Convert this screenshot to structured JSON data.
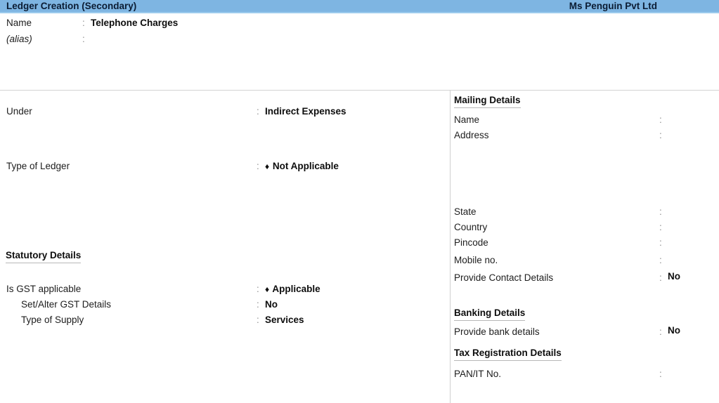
{
  "titlebar": {
    "screen_title": "Ledger Creation (Secondary)",
    "company_name": "Ms Penguin Pvt Ltd",
    "bar_color": "#7eb5e2",
    "text_color": "#0b1c33"
  },
  "identity": {
    "name_label": "Name",
    "name_value": "Telephone Charges",
    "alias_label": "(alias)",
    "alias_value": "",
    "colon": ":"
  },
  "left": {
    "under_label": "Under",
    "under_value": "Indirect Expenses",
    "type_of_ledger_label": "Type of Ledger",
    "type_of_ledger_value": "Not Applicable",
    "statutory_heading": "Statutory Details",
    "gst_applicable_label": "Is GST applicable",
    "gst_applicable_value": "Applicable",
    "set_alter_gst_label": "Set/Alter GST Details",
    "set_alter_gst_value": "No",
    "type_of_supply_label": "Type of Supply",
    "type_of_supply_value": "Services",
    "selector_marker": "♦"
  },
  "right": {
    "mailing_heading": "Mailing Details",
    "mailing_name_label": "Name",
    "mailing_name_value": "",
    "address_label": "Address",
    "address_value": "",
    "state_label": "State",
    "state_value": "",
    "country_label": "Country",
    "country_value": "",
    "pincode_label": "Pincode",
    "pincode_value": "",
    "mobile_label": "Mobile no.",
    "mobile_value": "",
    "contact_details_label": "Provide Contact Details",
    "contact_details_value": "No",
    "banking_heading": "Banking Details",
    "bank_details_label": "Provide bank details",
    "bank_details_value": "No",
    "tax_heading": "Tax Registration Details",
    "pan_label": "PAN/IT No.",
    "pan_value": "",
    "colon": ":"
  }
}
